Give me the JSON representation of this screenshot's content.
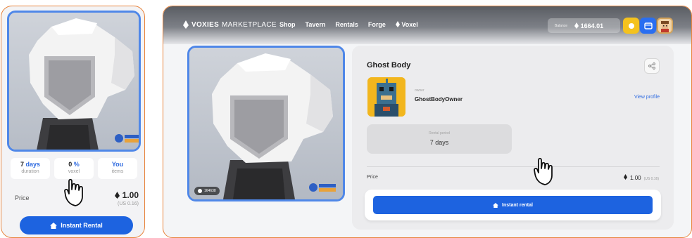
{
  "colors": {
    "accent_orange": "#e8843c",
    "primary_blue": "#1d63e0",
    "frame_blue": "#4f87e8",
    "link_blue": "#2f6be0"
  },
  "left_card": {
    "stats": [
      {
        "value_num": "7",
        "value_unit": "days",
        "label": "duration"
      },
      {
        "value_num": "0",
        "value_unit": "%",
        "label": "voxel"
      },
      {
        "value_num": "You",
        "value_unit": "",
        "label": "items"
      }
    ],
    "price_label": "Price",
    "price_value": "1.00",
    "price_usd": "(US 0.16)",
    "button_label": "Instant Rental"
  },
  "nav": {
    "logo_bold": "VOXIES",
    "logo_thin": "MARKETPLACE",
    "links": [
      "Shop",
      "Tavern",
      "Rentals",
      "Forge",
      "Voxel"
    ],
    "balance_label": "Balance",
    "balance_value": "1664.01"
  },
  "detail": {
    "item_name": "Ghost Body",
    "owner_label": "owner",
    "owner_name": "GhostBodyOwner",
    "view_profile": "View profile",
    "rental_period_label": "Rental period",
    "rental_period_value": "7 days",
    "price_label": "Price",
    "price_value": "1.00",
    "price_usd": "(US 0.16)",
    "button_label": "Instant rental"
  },
  "hero": {
    "badge": "164638"
  },
  "icons": [
    "voxel-token-icon",
    "home-icon",
    "share-icon",
    "wallet-icon",
    "sun-icon",
    "hand-pointer-icon"
  ]
}
